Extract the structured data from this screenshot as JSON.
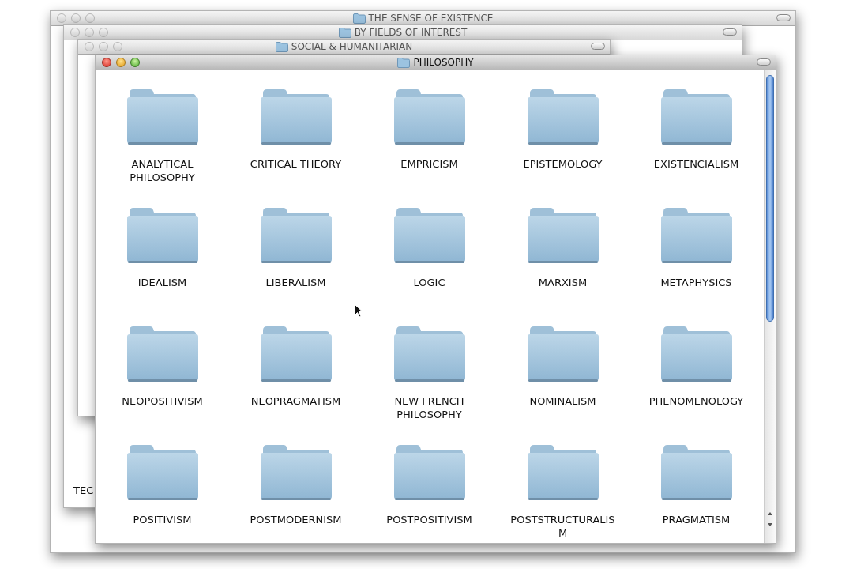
{
  "windows": [
    {
      "title": "THE SENSE OF EXISTENCE",
      "active": false
    },
    {
      "title": "BY FIELDS OF INTEREST",
      "active": false,
      "texts": [
        "TEC"
      ]
    },
    {
      "title": "SOCIAL & HUMANITARIAN",
      "active": false
    },
    {
      "title": "PHILOSOPHY",
      "active": true
    }
  ],
  "folders": [
    {
      "label": "ANALYTICAL PHILOSOPHY"
    },
    {
      "label": "CRITICAL THEORY"
    },
    {
      "label": "EMPRICISM"
    },
    {
      "label": "EPISTEMOLOGY"
    },
    {
      "label": "EXISTENCIALISM"
    },
    {
      "label": "IDEALISM"
    },
    {
      "label": "LIBERALISM"
    },
    {
      "label": "LOGIC"
    },
    {
      "label": "MARXISM"
    },
    {
      "label": "METAPHYSICS"
    },
    {
      "label": "NEOPOSITIVISM"
    },
    {
      "label": "NEOPRAGMATISM"
    },
    {
      "label": "NEW FRENCH PHILOSOPHY"
    },
    {
      "label": "NOMINALISM"
    },
    {
      "label": "PHENOMENOLOGY"
    },
    {
      "label": "POSITIVISM"
    },
    {
      "label": "POSTMODERNISM"
    },
    {
      "label": "POSTPOSITIVISM"
    },
    {
      "label": "POSTSTRUCTURALISM"
    },
    {
      "label": "PRAGMATISM"
    }
  ]
}
